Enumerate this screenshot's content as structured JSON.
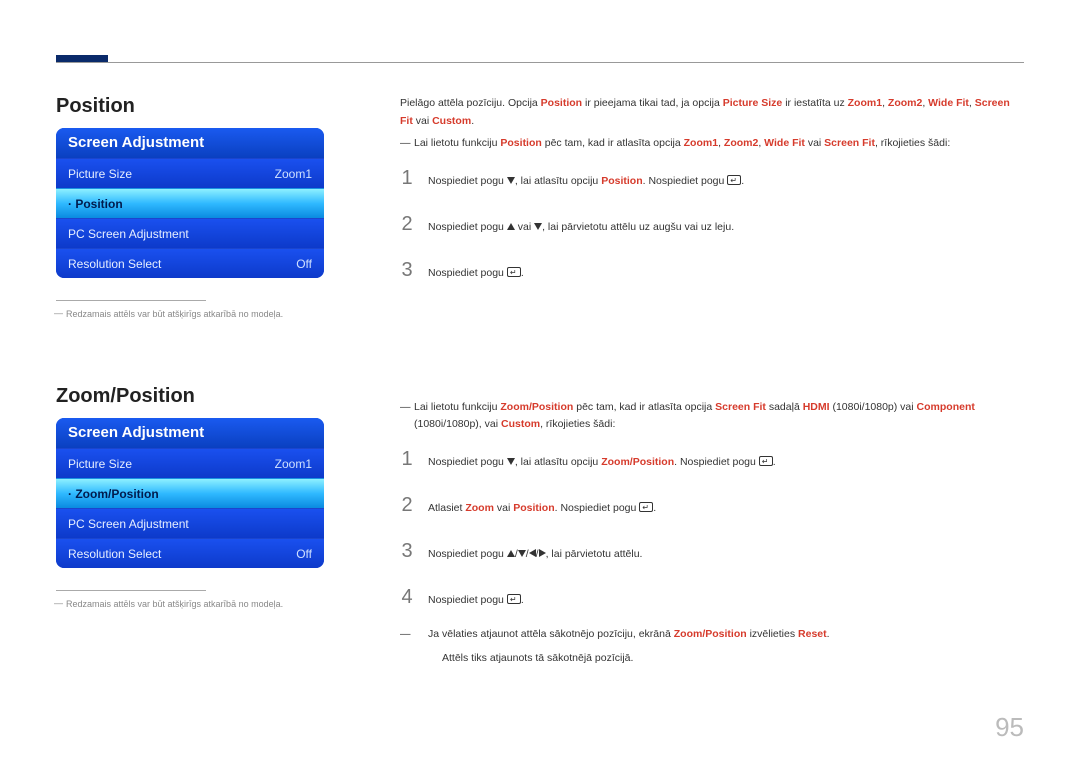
{
  "page_number": "95",
  "section1": {
    "heading": "Position",
    "osd_title": "Screen Adjustment",
    "rows": [
      {
        "label": "Picture Size",
        "value": "Zoom1",
        "selected": false
      },
      {
        "label": "· Position",
        "value": "",
        "selected": true
      },
      {
        "label": "PC Screen Adjustment",
        "value": "",
        "selected": false
      },
      {
        "label": "Resolution Select",
        "value": "Off",
        "selected": false
      }
    ],
    "footnote": "Redzamais attēls var būt atšķirīgs atkarībā no modeļa.",
    "intro_a": "Pielāgo attēla pozīciju. Opcija ",
    "intro_b": " ir pieejama tikai tad, ja opcija ",
    "intro_c": " ir iestatīta uz ",
    "intro_after": " vai ",
    "k_position": "Position",
    "k_picture_size": "Picture Size",
    "k_zoom1": "Zoom1",
    "k_zoom2": "Zoom2",
    "k_widefit": "Wide Fit",
    "k_screenfit": "Screen Fit",
    "k_custom": "Custom",
    "dash_a": "Lai lietotu funkciju ",
    "dash_b": " pēc tam, kad ir atlasīta opcija ",
    "dash_c": ", rīkojieties šādi:",
    "or": " vai ",
    "step1a": "Nospiediet pogu ",
    "step1b": ", lai atlasītu opciju ",
    "step1c": ". Nospiediet pogu ",
    "step2a": "Nospiediet pogu ",
    "step2b": " vai ",
    "step2c": ", lai pārvietotu attēlu uz augšu vai uz leju.",
    "step3a": "Nospiediet pogu "
  },
  "section2": {
    "heading": "Zoom/Position",
    "osd_title": "Screen Adjustment",
    "rows": [
      {
        "label": "Picture Size",
        "value": "Zoom1",
        "selected": false
      },
      {
        "label": "· Zoom/Position",
        "value": "",
        "selected": true
      },
      {
        "label": "PC Screen Adjustment",
        "value": "",
        "selected": false
      },
      {
        "label": "Resolution Select",
        "value": "Off",
        "selected": false
      }
    ],
    "footnote": "Redzamais attēls var būt atšķirīgs atkarībā no modeļa.",
    "dash_a": "Lai lietotu funkciju ",
    "k_zp": "Zoom/Position",
    "dash_b": " pēc tam, kad ir atlasīta opcija ",
    "k_screenfit": "Screen Fit",
    "dash_c": " sadaļā ",
    "k_hdmi": "HDMI",
    "res1": " (1080i/1080p) vai ",
    "k_component": "Component",
    "res2": " (1080i/1080p), vai ",
    "k_custom": "Custom",
    "dash_d": ", rīkojieties šādi:",
    "step1a": "Nospiediet pogu ",
    "step1b": ", lai atlasītu opciju ",
    "step1c": ". Nospiediet pogu ",
    "step2a": "Atlasiet ",
    "k_zoom": "Zoom",
    "step2b": " vai ",
    "k_position": "Position",
    "step2c": ". Nospiediet pogu ",
    "step3a": "Nospiediet pogu ",
    "step3b": ", lai pārvietotu attēlu.",
    "step4a": "Nospiediet pogu ",
    "tail_a": "Ja vēlaties atjaunot attēla sākotnējo pozīciju, ekrānā ",
    "tail_b": " izvēlieties ",
    "k_reset": "Reset",
    "tail2": "Attēls tiks atjaunots tā sākotnējā pozīcijā."
  }
}
